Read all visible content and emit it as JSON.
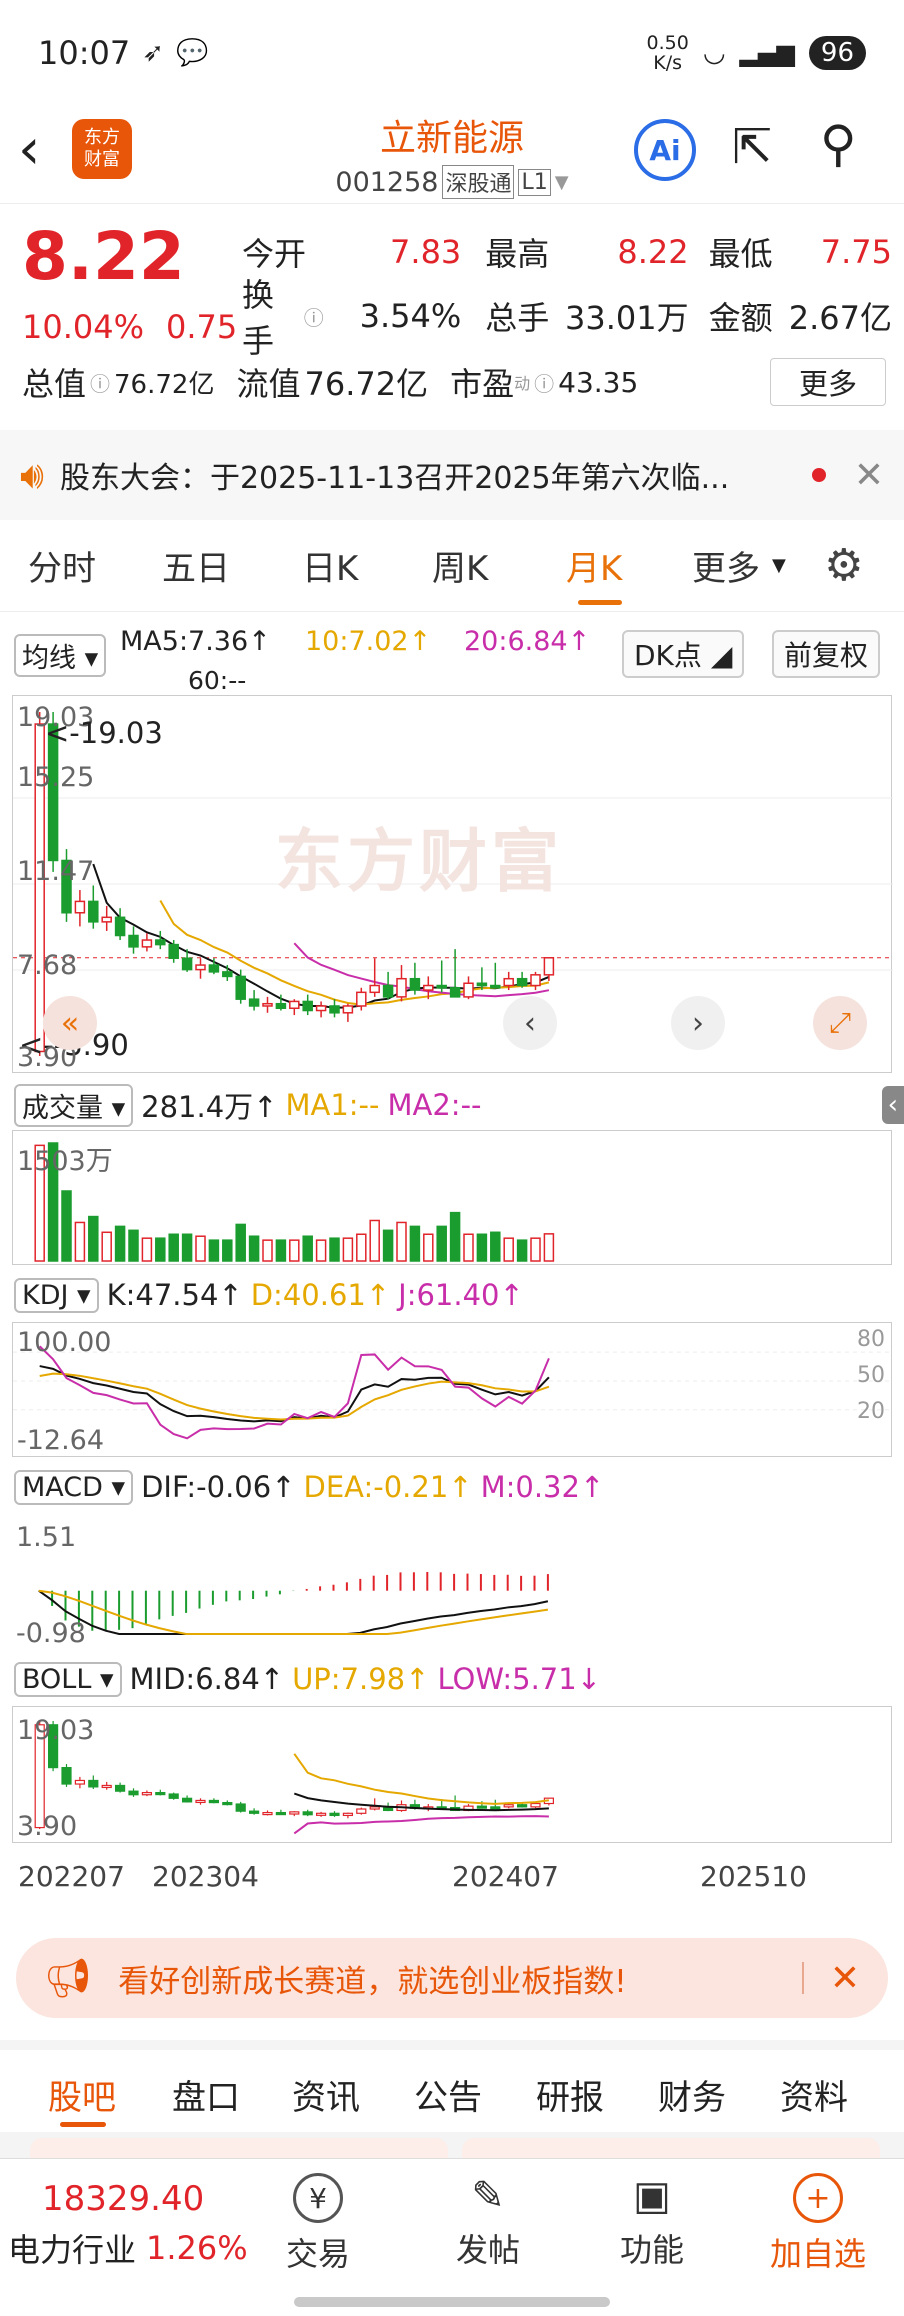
{
  "status": {
    "time": "10:07",
    "net_speed_top": "0.50",
    "net_speed_unit": "K/s",
    "battery": "96"
  },
  "header": {
    "title": "立新能源",
    "code": "001258",
    "badge1": "深股通",
    "badge2": "L1",
    "logo_text": "东方\n财富",
    "ai_label": "Ai"
  },
  "quote": {
    "price": "8.22",
    "pct": "10.04%",
    "chg": "0.75",
    "open_label": "今开",
    "open": "7.83",
    "high_label": "最高",
    "high": "8.22",
    "low_label": "最低",
    "low": "7.75",
    "turnover_label": "换手",
    "turnover": "3.54%",
    "vol_label": "总手",
    "vol": "33.01万",
    "amount_label": "金额",
    "amount": "2.67亿",
    "mcap_label": "总值",
    "mcap": "76.72亿",
    "float_label": "流值",
    "float": "76.72亿",
    "pe_label": "市盈",
    "pe_sup": "动",
    "pe": "43.35",
    "more": "更多"
  },
  "notice": {
    "text": "股东大会：于2025-11-13召开2025年第六次临..."
  },
  "chart_tabs": [
    "分时",
    "五日",
    "日K",
    "周K",
    "月K",
    "更多"
  ],
  "active_tab": "月K",
  "ma": {
    "selector": "均线",
    "ma5": "MA5:7.36↑",
    "ma10": "10:7.02↑",
    "ma20": "20:6.84↑",
    "ma60": "60:--",
    "dk": "DK点",
    "fq": "前复权"
  },
  "kline": {
    "high_label": "19.03",
    "high_ptr": "<-19.03",
    "y1": "15.25",
    "y2": "11.47",
    "y3": "7.68",
    "low_label": "3.90",
    "low_ptr": "<--3.90",
    "watermark": "东方财富"
  },
  "volume": {
    "selector": "成交量",
    "val": "281.4万↑",
    "ma1": "MA1:--",
    "ma2": "MA2:--",
    "max": "1503万"
  },
  "kdj": {
    "selector": "KDJ",
    "k": "K:47.54↑",
    "d": "D:40.61↑",
    "j": "J:61.40↑",
    "top": "100.00",
    "bottom": "-12.64",
    "l80": "80",
    "l50": "50",
    "l20": "20"
  },
  "macd": {
    "selector": "MACD",
    "dif": "DIF:-0.06↑",
    "dea": "DEA:-0.21↑",
    "m": "M:0.32↑",
    "top": "1.51",
    "bottom": "-0.98"
  },
  "boll": {
    "selector": "BOLL",
    "mid": "MID:6.84↑",
    "up": "UP:7.98↑",
    "low": "LOW:5.71↓",
    "top": "19.03",
    "bottom": "3.90"
  },
  "dates": [
    "202207",
    "202304",
    "202407",
    "202510"
  ],
  "ad": {
    "text": "看好创新成长赛道，就选创业板指数!"
  },
  "bottom_tabs": [
    "股吧",
    "盘口",
    "资讯",
    "公告",
    "研报",
    "财务",
    "资料"
  ],
  "footer": {
    "index_val": "18329.40",
    "index_name": "电力行业",
    "index_pct": "1.26%",
    "trade": "交易",
    "post": "发帖",
    "func": "功能",
    "add": "加自选"
  },
  "colors": {
    "up": "#e0242a",
    "down": "#1a9c2e",
    "accent": "#e8710a"
  },
  "chart_data": {
    "type": "candlestick",
    "title": "",
    "ylim": [
      3.9,
      19.03
    ],
    "candles": [
      [
        4.1,
        19.03,
        3.9,
        18.5
      ],
      [
        18.5,
        19.03,
        12.0,
        12.5
      ],
      [
        12.5,
        13.0,
        9.8,
        10.2
      ],
      [
        10.2,
        11.2,
        9.6,
        10.7
      ],
      [
        10.7,
        11.4,
        9.5,
        9.8
      ],
      [
        9.8,
        10.5,
        9.4,
        10.0
      ],
      [
        10.0,
        10.4,
        9.0,
        9.2
      ],
      [
        9.2,
        9.6,
        8.4,
        8.7
      ],
      [
        8.7,
        9.3,
        8.5,
        9.0
      ],
      [
        9.0,
        9.4,
        8.6,
        8.8
      ],
      [
        8.8,
        9.0,
        8.0,
        8.2
      ],
      [
        8.2,
        8.6,
        7.6,
        7.7
      ],
      [
        7.7,
        8.2,
        7.3,
        7.9
      ],
      [
        7.9,
        8.2,
        7.5,
        7.6
      ],
      [
        7.6,
        7.9,
        7.2,
        7.4
      ],
      [
        7.4,
        7.7,
        6.2,
        6.4
      ],
      [
        6.4,
        6.8,
        5.9,
        6.1
      ],
      [
        6.1,
        6.5,
        5.8,
        6.2
      ],
      [
        6.2,
        6.6,
        5.9,
        6.0
      ],
      [
        6.0,
        6.4,
        5.7,
        6.3
      ],
      [
        6.3,
        6.6,
        5.7,
        5.9
      ],
      [
        5.9,
        6.3,
        5.6,
        6.1
      ],
      [
        6.1,
        6.4,
        5.6,
        5.8
      ],
      [
        5.8,
        6.2,
        5.4,
        6.1
      ],
      [
        6.1,
        6.9,
        5.9,
        6.7
      ],
      [
        6.7,
        8.2,
        6.5,
        7.0
      ],
      [
        7.0,
        7.6,
        6.4,
        6.5
      ],
      [
        6.5,
        7.9,
        6.3,
        7.3
      ],
      [
        7.3,
        8.0,
        6.6,
        6.8
      ],
      [
        6.8,
        7.4,
        6.4,
        7.0
      ],
      [
        7.0,
        8.1,
        6.7,
        6.9
      ],
      [
        6.9,
        8.6,
        6.5,
        6.5
      ],
      [
        6.5,
        7.4,
        6.4,
        7.1
      ],
      [
        7.1,
        7.8,
        6.8,
        7.0
      ],
      [
        7.0,
        8.0,
        6.9,
        6.9
      ],
      [
        7.0,
        7.6,
        6.8,
        7.3
      ],
      [
        7.3,
        7.6,
        6.9,
        7.0
      ],
      [
        7.0,
        7.6,
        6.8,
        7.47
      ],
      [
        7.47,
        8.22,
        7.2,
        8.22
      ]
    ]
  }
}
